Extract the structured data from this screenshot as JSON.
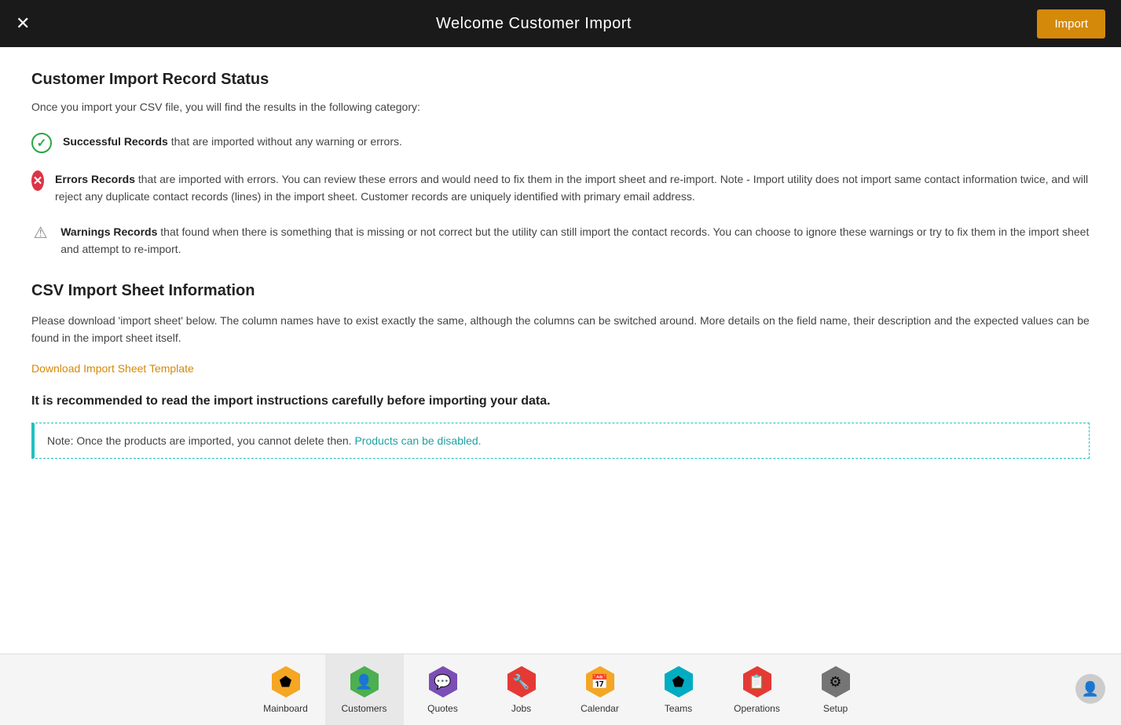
{
  "header": {
    "title": "Welcome Customer Import",
    "close_label": "✕",
    "import_label": "Import"
  },
  "content": {
    "record_status": {
      "section_title": "Customer Import Record Status",
      "intro": "Once you import your CSV file, you will find the results in the following category:",
      "records": [
        {
          "type": "success",
          "label": "Successful Records",
          "description": " that are imported without any warning or errors."
        },
        {
          "type": "error",
          "label": "Errors Records",
          "description": " that are imported with errors. You can review these errors and would need to fix them in the import sheet and re-import. Note - Import utility does not import same contact information twice, and will reject any duplicate contact records (lines) in the import sheet. Customer records are uniquely identified with primary email address."
        },
        {
          "type": "warning",
          "label": "Warnings Records",
          "description": " that found when there is something that is missing or not correct but the utility can still import the contact records. You can choose to ignore these warnings or try to fix them in the import sheet and attempt to re-import."
        }
      ]
    },
    "csv_section": {
      "section_title": "CSV Import Sheet Information",
      "description": "Please download 'import sheet' below. The column names have to exist exactly the same, although the columns can be switched around. More details on the field name, their description and the expected values can be found in the import sheet itself.",
      "download_label": "Download Import Sheet Template",
      "recommendation": "It is recommended to read the import instructions carefully before importing your data.",
      "note": "Note: Once the products are imported, you cannot delete then. Products can be disabled.",
      "note_highlight": "Products can be disabled."
    }
  },
  "bottom_nav": {
    "items": [
      {
        "id": "mainboard",
        "label": "Mainboard",
        "color": "#f5a623",
        "icon": "⬡",
        "active": false
      },
      {
        "id": "customers",
        "label": "Customers",
        "color": "#4caf50",
        "icon": "👤",
        "active": true
      },
      {
        "id": "quotes",
        "label": "Quotes",
        "color": "#7b4fb5",
        "icon": "💬",
        "active": false
      },
      {
        "id": "jobs",
        "label": "Jobs",
        "color": "#e53935",
        "icon": "🔧",
        "active": false
      },
      {
        "id": "calendar",
        "label": "Calendar",
        "color": "#f5a623",
        "icon": "📅",
        "active": false
      },
      {
        "id": "teams",
        "label": "Teams",
        "color": "#00acc1",
        "icon": "⬡",
        "active": false
      },
      {
        "id": "operations",
        "label": "Operations",
        "color": "#e53935",
        "icon": "📋",
        "active": false
      },
      {
        "id": "setup",
        "label": "Setup",
        "color": "#757575",
        "icon": "⚙",
        "active": false
      }
    ]
  }
}
